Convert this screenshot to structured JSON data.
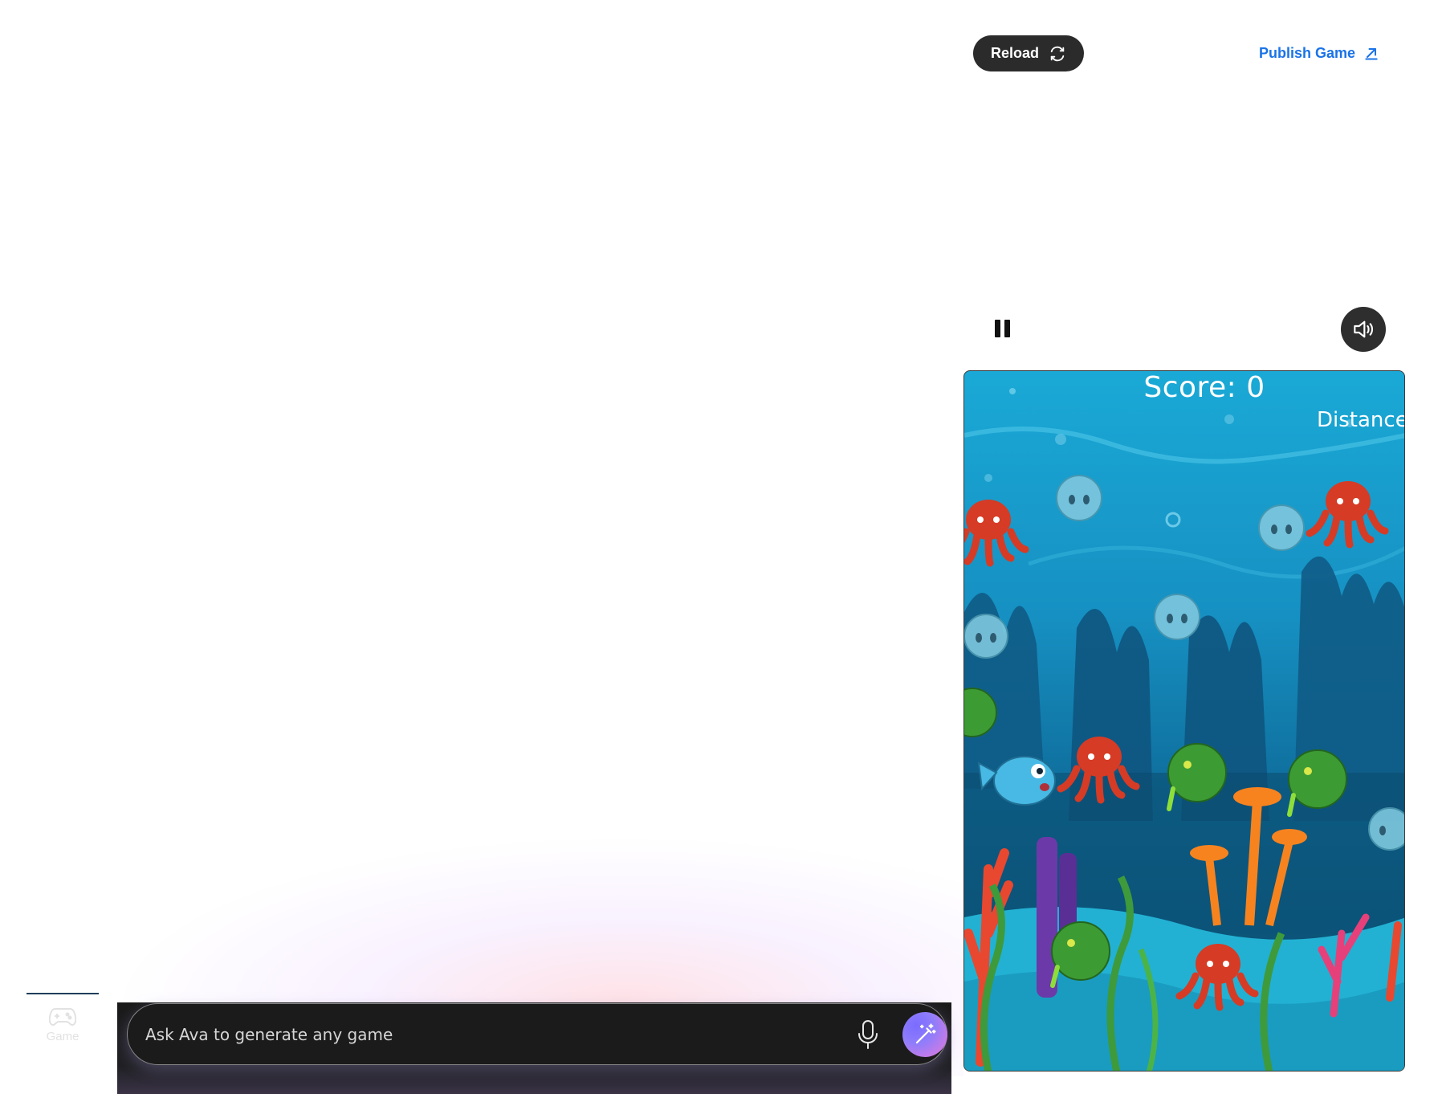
{
  "toolbar": {
    "reload_label": "Reload",
    "reload_icon": "refresh-icon",
    "publish_label": "Publish Game",
    "publish_icon": "arrow-up-right-icon",
    "publish_color": "#1a73e8"
  },
  "controls": {
    "pause_icon": "pause-icon",
    "sound_icon": "speaker-icon"
  },
  "game": {
    "score_text": "Score: 0",
    "distance_text": "Distance:"
  },
  "nav": {
    "game_label": "Game",
    "game_icon": "gamepad-icon"
  },
  "prompt": {
    "placeholder": "Ask Ava to generate any game",
    "value": "",
    "mic_icon": "microphone-icon",
    "generate_icon": "magic-wand-icon"
  }
}
